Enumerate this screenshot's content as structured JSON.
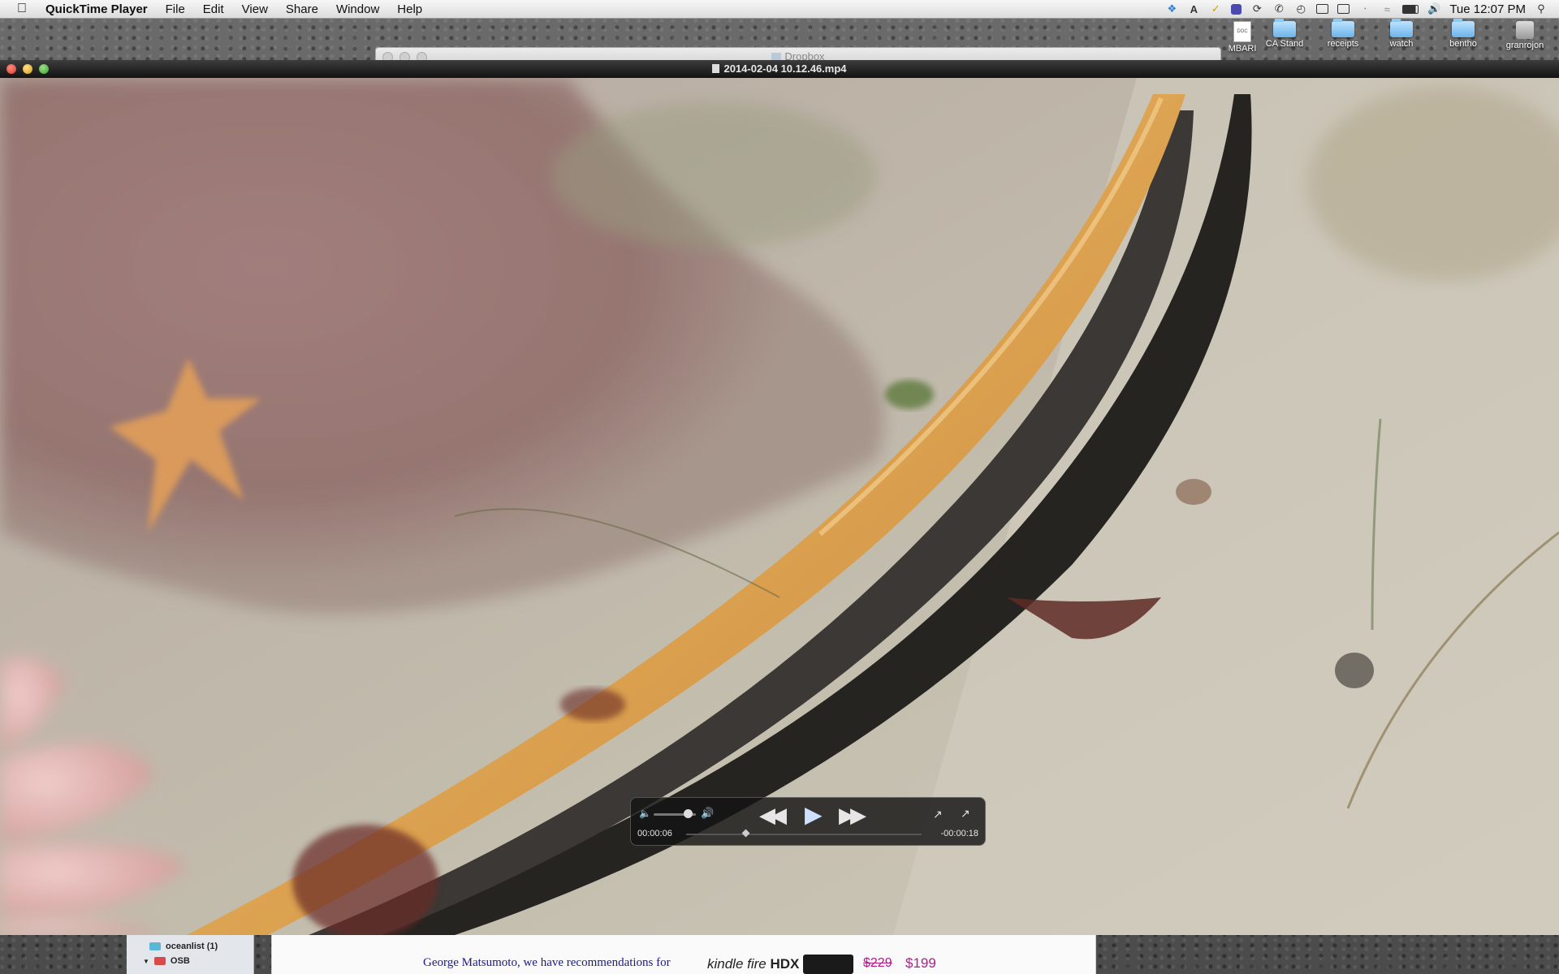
{
  "menubar": {
    "app_name": "QuickTime Player",
    "items": [
      "File",
      "Edit",
      "View",
      "Share",
      "Window",
      "Help"
    ],
    "clock": "Tue 12:07 PM"
  },
  "desktop_icons": [
    {
      "label": "MBARI",
      "kind": "doc"
    },
    {
      "label": "CA Stand",
      "kind": "folder"
    },
    {
      "label": "receipts",
      "kind": "folder"
    },
    {
      "label": "watch",
      "kind": "folder"
    },
    {
      "label": "bentho",
      "kind": "folder"
    },
    {
      "label": "granrojon",
      "kind": "disk"
    }
  ],
  "background_window": {
    "title": "Dropbox"
  },
  "player": {
    "title": "2014-02-04 10.12.46.mp4",
    "time_elapsed": "00:00:06",
    "time_remaining": "-00:00:18",
    "progress_fraction": 0.25,
    "volume_fraction": 0.8
  },
  "background_sidebar": {
    "items": [
      "oceanlist (1)",
      "OSB"
    ]
  },
  "background_page": {
    "recommendation_text": "George Matsumoto, we have recommendations for",
    "ad_brand": "kindle fire",
    "ad_model": "HDX",
    "ad_old_price": "$229",
    "ad_new_price": "$199"
  },
  "colors": {
    "titlebar": "#1c1c1c",
    "hose_yellow": "#e0a650",
    "hose_black": "#262421",
    "sand": "#c6c0b0",
    "reddish_rock": "#9e7b78"
  }
}
